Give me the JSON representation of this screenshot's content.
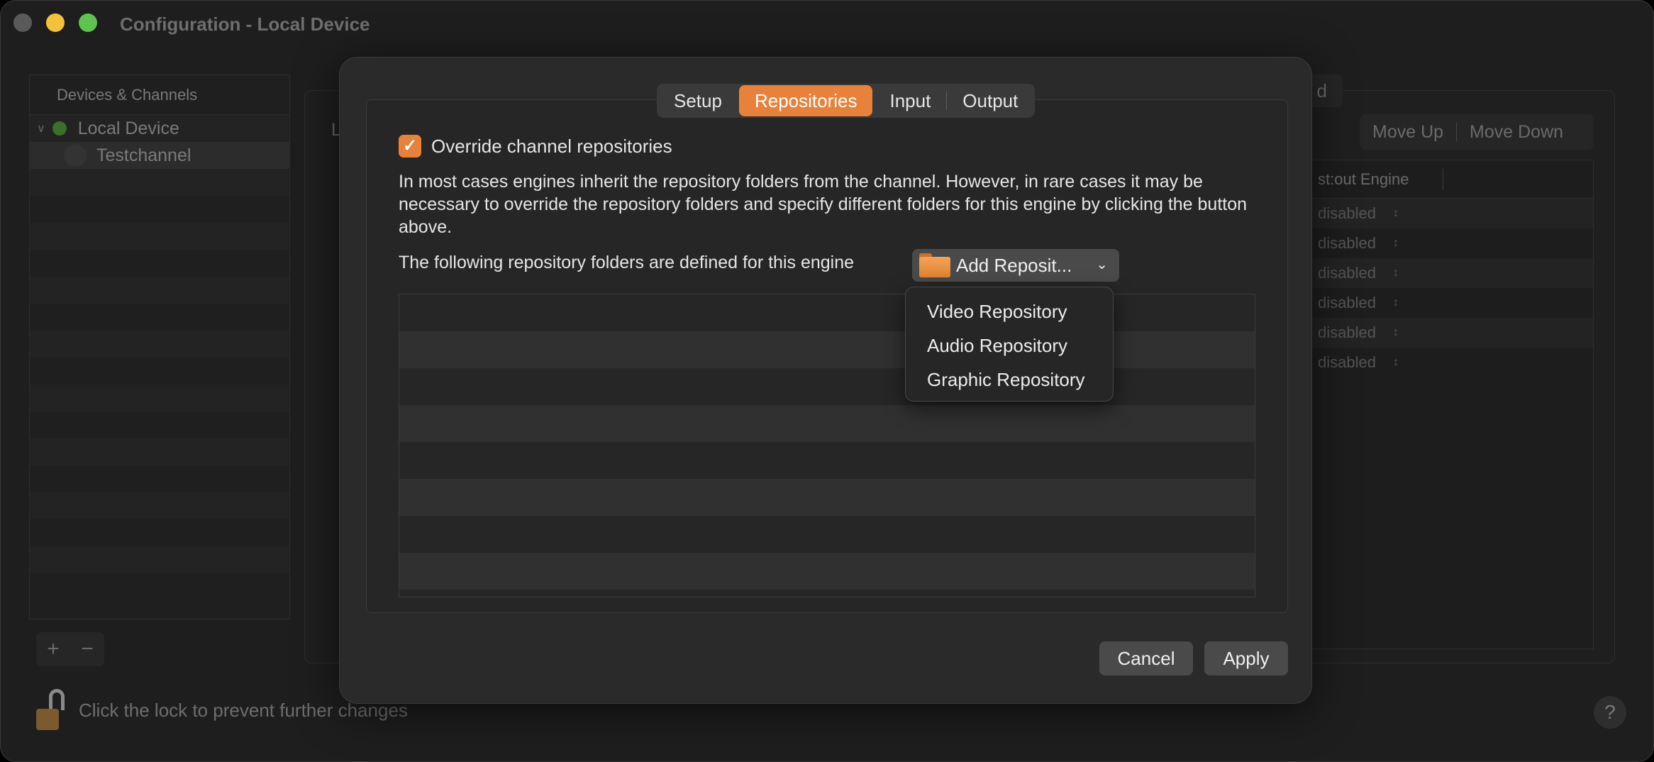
{
  "window": {
    "title": "Configuration - Local Device"
  },
  "sidebar": {
    "header": "Devices & Channels",
    "items": [
      {
        "label": "Local Device"
      },
      {
        "label": "Testchannel"
      }
    ]
  },
  "footer": {
    "add": "+",
    "remove": "−",
    "lock_text": "Click the lock to prevent further changes",
    "help": "?"
  },
  "background": {
    "label_L": "L",
    "tab_partial": "d",
    "move_up": "Move Up",
    "move_down": "Move Down",
    "table_header": "st:out Engine",
    "rows": [
      "disabled",
      "disabled",
      "disabled",
      "disabled",
      "disabled",
      "disabled"
    ]
  },
  "sheet": {
    "tabs": [
      {
        "label": "Setup"
      },
      {
        "label": "Repositories"
      },
      {
        "label": "Input"
      },
      {
        "label": "Output"
      }
    ],
    "override_label": "Override channel repositories",
    "description": "In most cases engines inherit the repository folders from the channel. However, in rare cases it may be necessary to override the repository folders and specify different folders for this engine by clicking the button above.",
    "folders_label": "The following repository folders are defined for this engine",
    "add_button": "Add Reposit...",
    "menu": [
      {
        "label": "Video Repository"
      },
      {
        "label": "Audio Repository"
      },
      {
        "label": "Graphic Repository"
      }
    ],
    "cancel": "Cancel",
    "apply": "Apply"
  },
  "colors": {
    "accent": "#e8823a"
  }
}
